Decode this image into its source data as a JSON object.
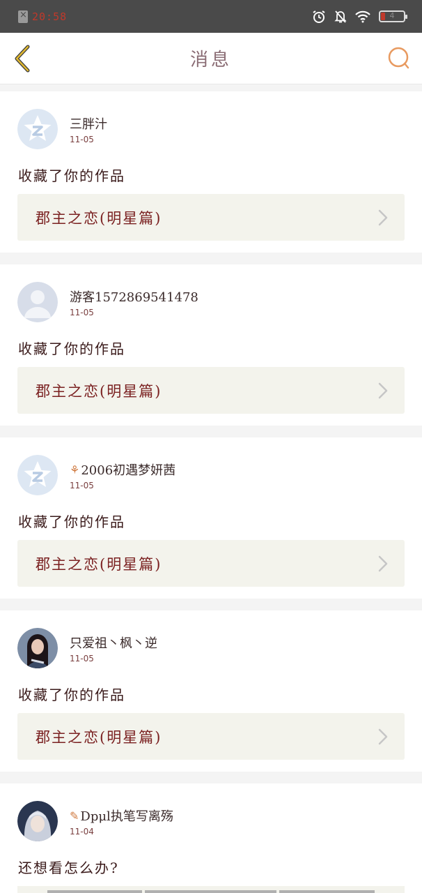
{
  "status_bar": {
    "time": "20:58",
    "battery_level": "4",
    "icons": [
      "sim-absent-icon",
      "alarm-icon",
      "notifications-off-icon",
      "wifi-icon",
      "battery-icon"
    ]
  },
  "header": {
    "title": "消息",
    "back_icon": "chevron-left-icon",
    "search_icon": "search-icon"
  },
  "colors": {
    "accent_back": "#e0b830",
    "accent_search": "#e89a60",
    "title": "#8a6c74",
    "work_title": "#7a2020",
    "card_bg": "#ffffff",
    "work_bg": "#f3f3ec"
  },
  "messages": [
    {
      "avatar": "qzone-default-avatar",
      "username": "三胖汁",
      "date": "11-05",
      "action": "收藏了你的作品",
      "work_title": "郡主之恋(明星篇)"
    },
    {
      "avatar": "guest-default-avatar",
      "username": "游客1572869541478",
      "date": "11-05",
      "action": "收藏了你的作品",
      "work_title": "郡主之恋(明星篇)"
    },
    {
      "avatar": "qzone-default-avatar",
      "username": "2006初遇梦妍茜",
      "date": "11-05",
      "action": "收藏了你的作品",
      "work_title": "郡主之恋(明星篇)"
    },
    {
      "avatar": "photo-avatar-woman",
      "username": "只爱祖丶枫丶逆",
      "date": "11-05",
      "action": "收藏了你的作品",
      "work_title": "郡主之恋(明星篇)"
    },
    {
      "avatar": "photo-avatar-anime",
      "username": "Dpμl执笔写离殇",
      "date": "11-04",
      "action": "还想看怎么办?"
    }
  ]
}
